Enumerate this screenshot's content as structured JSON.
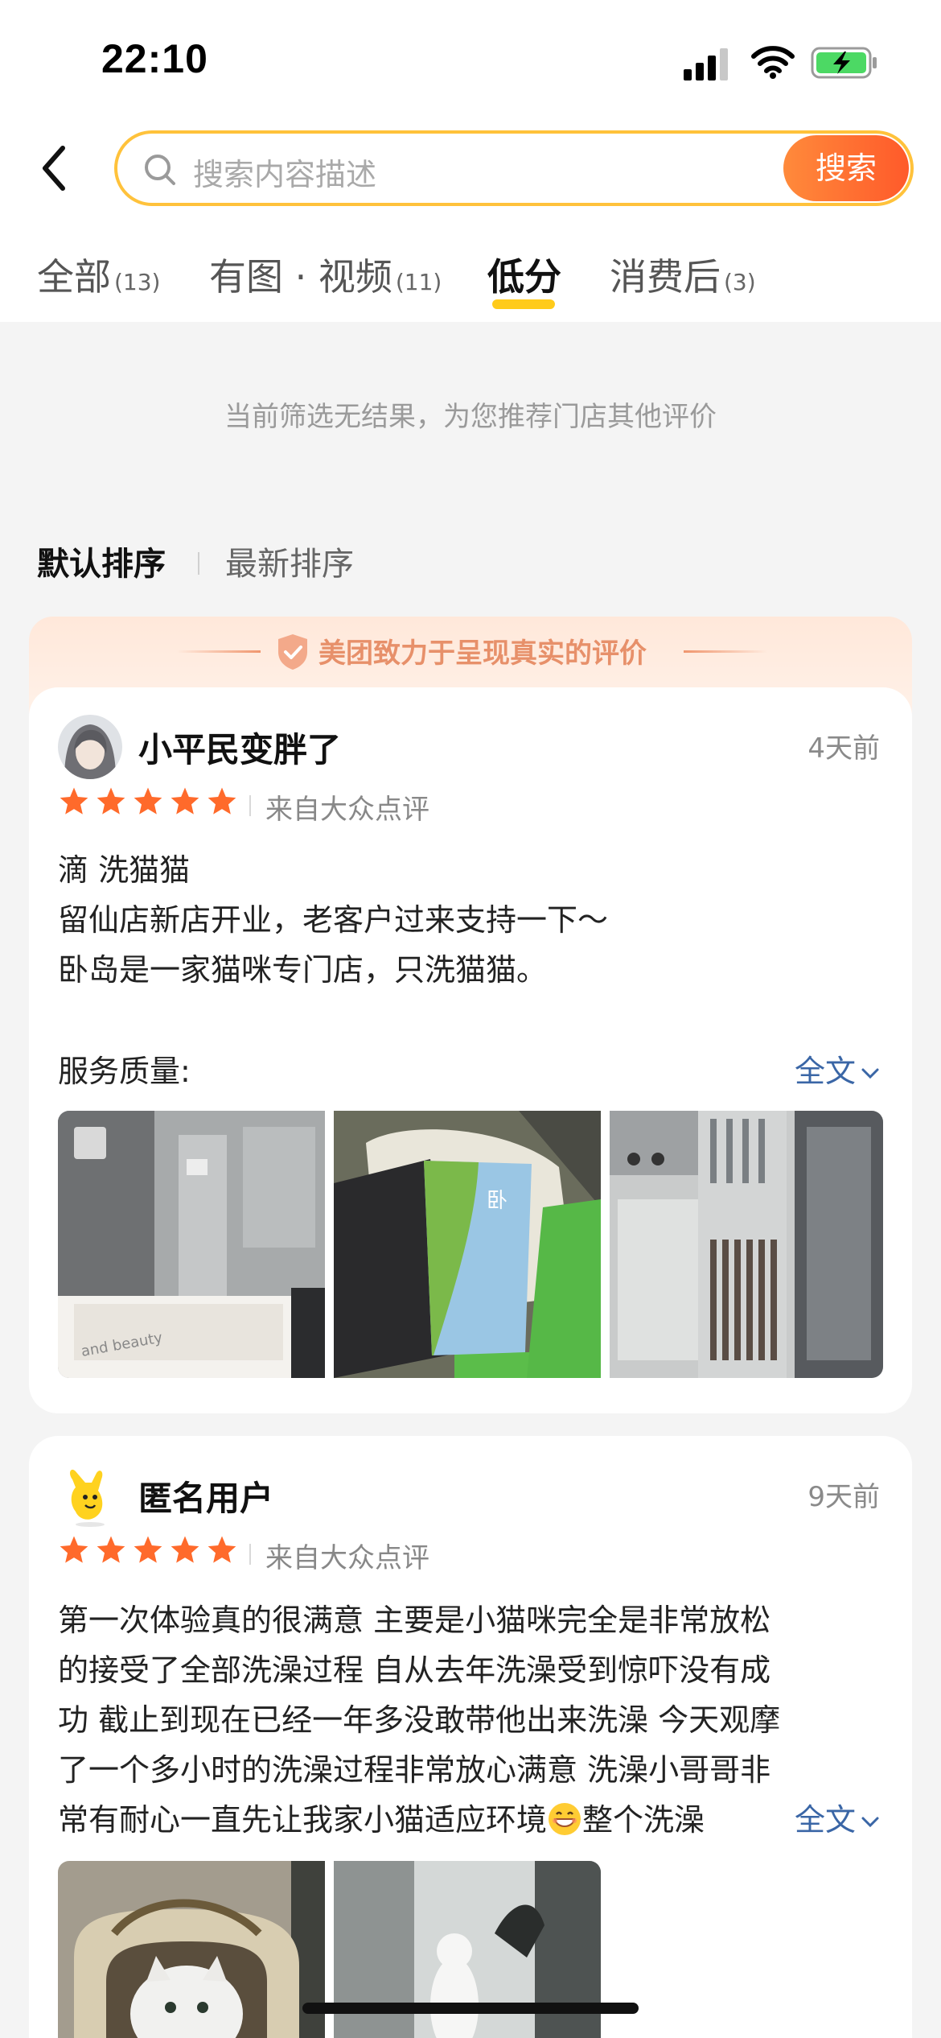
{
  "status_bar": {
    "time": "22:10"
  },
  "search": {
    "placeholder": "搜索内容描述",
    "button_label": "搜索"
  },
  "tabs": [
    {
      "label": "全部",
      "count": "(13)"
    },
    {
      "label": "有图 · 视频",
      "count": "(11)"
    },
    {
      "label": "低分",
      "count": ""
    },
    {
      "label": "消费后",
      "count": "(3)"
    }
  ],
  "active_tab": "低分",
  "notice": "当前筛选无结果，为您推荐门店其他评价",
  "sort": {
    "default_label": "默认排序",
    "latest_label": "最新排序"
  },
  "banner": {
    "text": "美团致力于呈现真实的评价"
  },
  "reviews": [
    {
      "username": "小平民变胖了",
      "time_ago": "4天前",
      "rating": 5,
      "source": "来自大众点评",
      "lines": [
        "滴 洗猫猫",
        "留仙店新店开业，老客户过来支持一下～",
        "卧岛是一家猫咪专门店，只洗猫猫。"
      ],
      "service_label": "服务质量:",
      "fulltext_label": "全文",
      "photos": [
        "bathroom-photo",
        "cat-bag-card-photo",
        "cage-room-photo"
      ]
    },
    {
      "username": "匿名用户",
      "time_ago": "9天前",
      "rating": 5,
      "source": "来自大众点评",
      "lines": [
        "第一次体验真的很满意 主要是小猫咪完全是非常放松",
        "的接受了全部洗澡过程 自从去年洗澡受到惊吓没有成",
        "功 截止到现在已经一年多没敢带他出来洗澡 今天观摩",
        "了一个多小时的洗澡过程非常放心满意 洗澡小哥哥非",
        "常有耐心一直先让我家小猫适应环境",
        "整个洗澡"
      ],
      "fulltext_label": "全文",
      "photos": [
        "cat-in-bag-photo",
        "cat-in-glass-room-photo"
      ]
    }
  ],
  "colors": {
    "accent_orange": "#ff6a2b",
    "tab_underline": "#ffcb1a",
    "search_border": "#ffc23b",
    "star": "#ff6a2b",
    "link": "#3a66a6",
    "banner_text": "#e7906a"
  }
}
